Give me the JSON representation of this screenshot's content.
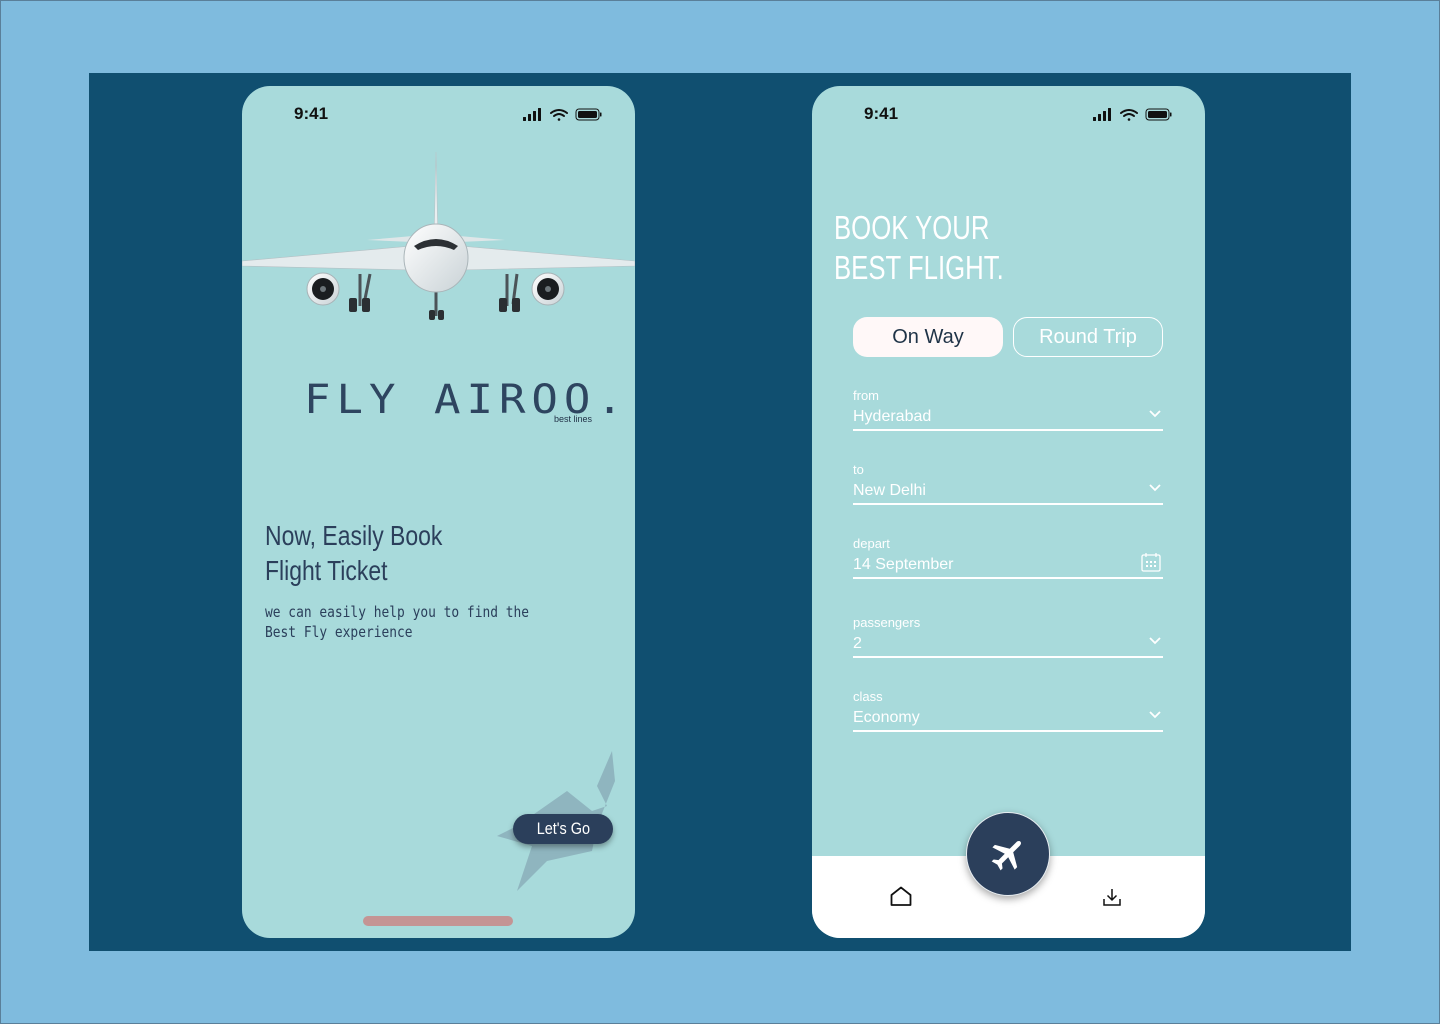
{
  "colors": {
    "outer_background": "#7fbbde",
    "panel_background": "#104f70",
    "screen_background": "#a8dadb",
    "accent_dark": "#2b3f5b",
    "home_indicator": "#c49494"
  },
  "welcome_screen": {
    "status_time": "9:41",
    "brand_name": "FLY AIROO.",
    "brand_tagline": "best lines",
    "headline_line1": "Now, Easily Book",
    "headline_line2": "Flight Ticket",
    "subtext_line1": "we can easily help you to find the",
    "subtext_line2": "Best Fly experience",
    "cta_label": "Let's Go"
  },
  "booking_screen": {
    "status_time": "9:41",
    "title_line1": "BOOK YOUR",
    "title_line2": "BEST FLIGHT.",
    "trip_options": [
      {
        "label": "On Way",
        "selected": true
      },
      {
        "label": "Round Trip",
        "selected": false
      }
    ],
    "fields": {
      "from": {
        "label": "from",
        "value": "Hyderabad",
        "icon": "chevron-down-icon"
      },
      "to": {
        "label": "to",
        "value": "New Delhi",
        "icon": "chevron-down-icon"
      },
      "depart": {
        "label": "depart",
        "value": "14 September",
        "icon": "calendar-icon"
      },
      "passengers": {
        "label": "passengers",
        "value": "2",
        "icon": "chevron-down-icon"
      },
      "class": {
        "label": "class",
        "value": "Economy",
        "icon": "chevron-down-icon"
      }
    },
    "nav": {
      "left_icon": "home-icon",
      "center_icon": "airplane-icon",
      "right_icon": "download-icon"
    }
  }
}
